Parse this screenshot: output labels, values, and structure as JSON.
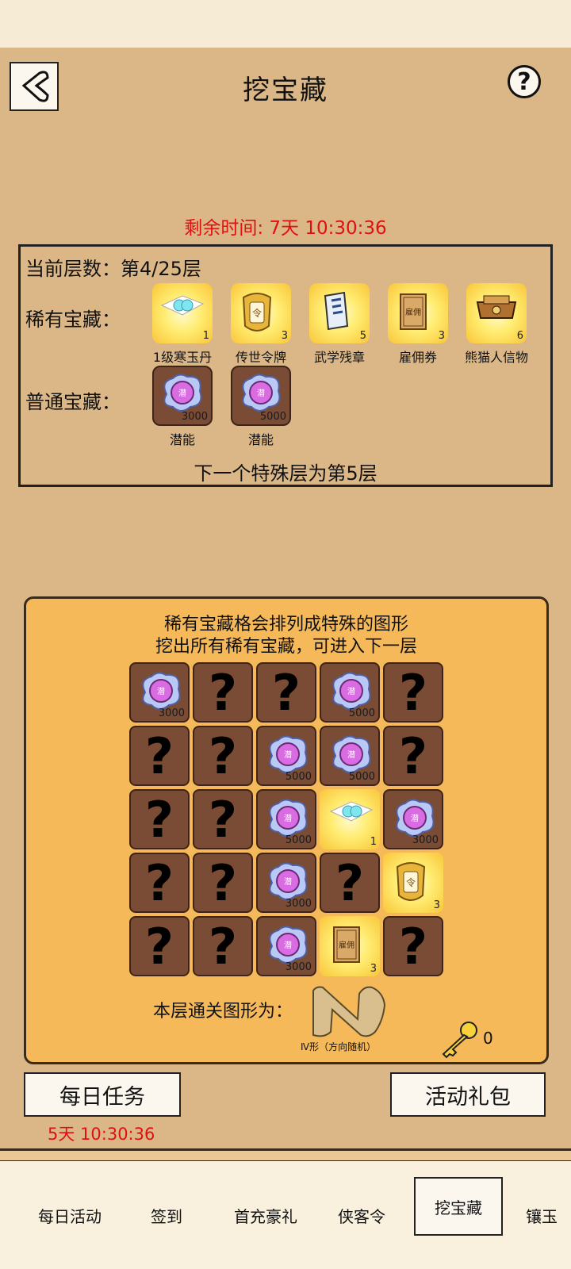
{
  "header": {
    "title": "挖宝藏",
    "help": "?"
  },
  "timer": "剩余时间: 7天 10:30:36",
  "info": {
    "floor": "当前层数：第4/25层",
    "rare_label": "稀有宝藏：",
    "common_label": "普通宝藏：",
    "rare_items": [
      {
        "name": "1级寒玉丹",
        "qty": "1",
        "icon": "pill-icon"
      },
      {
        "name": "传世令牌",
        "qty": "3",
        "icon": "token-icon"
      },
      {
        "name": "武学残章",
        "qty": "5",
        "icon": "scroll-icon"
      },
      {
        "name": "雇佣券",
        "qty": "3",
        "icon": "voucher-icon"
      },
      {
        "name": "熊猫人信物",
        "qty": "6",
        "icon": "box-icon"
      }
    ],
    "common_items": [
      {
        "name": "潜能",
        "qty": "3000",
        "icon": "potential-orb-icon"
      },
      {
        "name": "潜能",
        "qty": "5000",
        "icon": "potential-orb-icon"
      }
    ],
    "next_special": "下一个特殊层为第5层"
  },
  "board": {
    "hint1": "稀有宝藏格会排列成特殊的图形",
    "hint2": "挖出所有稀有宝藏，可进入下一层",
    "cells": [
      {
        "state": "common",
        "qty": "3000"
      },
      {
        "state": "hidden",
        "mark": "?"
      },
      {
        "state": "hidden",
        "mark": "?"
      },
      {
        "state": "common",
        "qty": "5000"
      },
      {
        "state": "hidden",
        "mark": "?"
      },
      {
        "state": "hidden",
        "mark": "?"
      },
      {
        "state": "hidden",
        "mark": "?"
      },
      {
        "state": "common",
        "qty": "5000"
      },
      {
        "state": "common",
        "qty": "5000"
      },
      {
        "state": "hidden",
        "mark": "?"
      },
      {
        "state": "hidden",
        "mark": "?"
      },
      {
        "state": "hidden",
        "mark": "?"
      },
      {
        "state": "common",
        "qty": "5000"
      },
      {
        "state": "rare",
        "item": "pill",
        "qty": "1"
      },
      {
        "state": "common",
        "qty": "3000"
      },
      {
        "state": "hidden",
        "mark": "?"
      },
      {
        "state": "hidden",
        "mark": "?"
      },
      {
        "state": "common",
        "qty": "3000"
      },
      {
        "state": "hidden",
        "mark": "?"
      },
      {
        "state": "rare",
        "item": "token",
        "qty": "3"
      },
      {
        "state": "hidden",
        "mark": "?"
      },
      {
        "state": "hidden",
        "mark": "?"
      },
      {
        "state": "common",
        "qty": "3000"
      },
      {
        "state": "rare",
        "item": "voucher",
        "qty": "3"
      },
      {
        "state": "hidden",
        "mark": "?"
      }
    ],
    "shape_label": "本层通关图形为：",
    "shape_caption": "Ⅳ形（方向随机）",
    "key_count": "0"
  },
  "buttons": {
    "daily": "每日任务",
    "gift": "活动礼包",
    "daily_timer": "5天 10:30:36"
  },
  "tabs": [
    "每日活动",
    "签到",
    "首充豪礼",
    "侠客令",
    "挖宝藏",
    "镶玉"
  ],
  "active_tab": "挖宝藏"
}
